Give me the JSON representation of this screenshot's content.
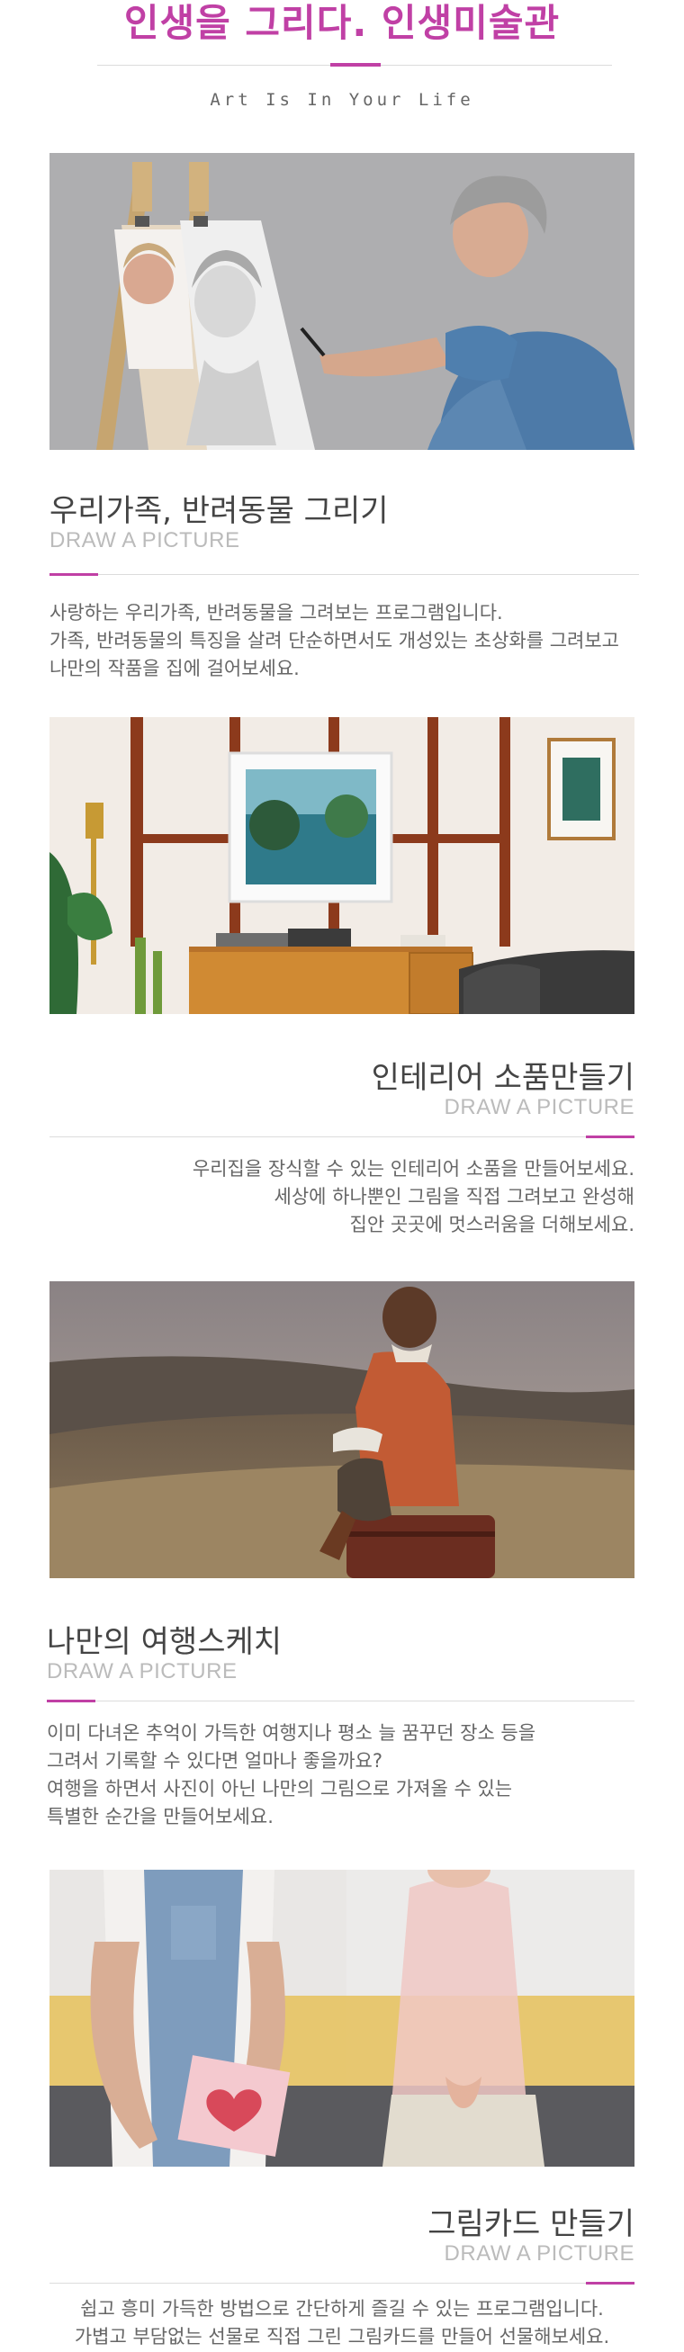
{
  "header": {
    "title": "인생을 그리다. 인생미술관",
    "subtitle": "Art Is In Your Life"
  },
  "brand_color": "#c040a5",
  "sections": [
    {
      "title": "우리가족, 반려동물 그리기",
      "subtitle": "DRAW A PICTURE",
      "body": [
        "사랑하는 우리가족, 반려동물을 그려보는 프로그램입니다.",
        "가족, 반려동물의 특징을 살려 단순하면서도 개성있는 초상화를 그려보고",
        "나만의 작품을 집에 걸어보세요."
      ]
    },
    {
      "title": "인테리어 소품만들기",
      "subtitle": "DRAW A PICTURE",
      "body": [
        "우리집을 장식할 수 있는 인테리어 소품을 만들어보세요.",
        "세상에 하나뿐인 그림을 직접 그려보고 완성해",
        "집안 곳곳에 멋스러움을 더해보세요."
      ]
    },
    {
      "title": "나만의 여행스케치",
      "subtitle": "DRAW A PICTURE",
      "body": [
        "이미 다녀온 추억이 가득한 여행지나 평소 늘 꿈꾸던 장소 등을",
        "그려서 기록할 수 있다면 얼마나 좋을까요?",
        "여행을 하면서 사진이 아닌 나만의 그림으로 가져올 수 있는",
        "특별한 순간을 만들어보세요."
      ]
    },
    {
      "title": "그림카드 만들기",
      "subtitle": "DRAW A PICTURE",
      "body": [
        "쉽고 흥미 가득한 방법으로 간단하게 즐길 수 있는 프로그램입니다.",
        "가볍고 부담없는 선물로 직접 그린 그림카드를 만들어 선물해보세요."
      ]
    }
  ]
}
